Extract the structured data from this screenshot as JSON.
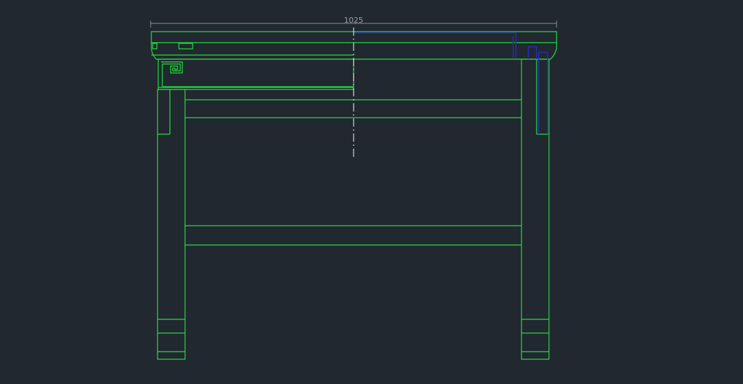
{
  "drawing": {
    "background_color": "#212830",
    "line_color": "#22e23a",
    "highlight_color": "#2b2bb0",
    "dimension_color": "#8a9096",
    "overall_width_dimension": "1025"
  }
}
